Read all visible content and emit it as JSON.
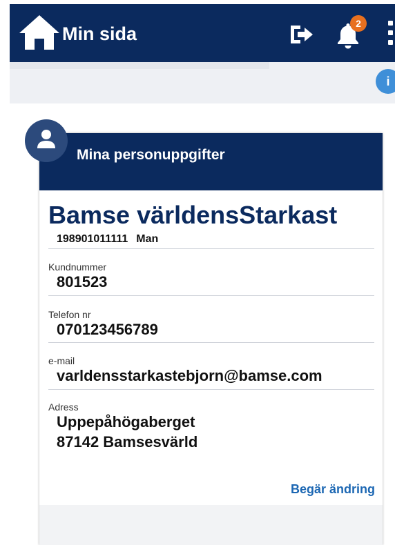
{
  "header": {
    "title": "Min sida",
    "icons": [
      "home-icon",
      "logout-icon",
      "bell-icon",
      "more-vertical-icon"
    ],
    "notification_count": "2"
  },
  "subbar": {
    "info_label": "i"
  },
  "profile": {
    "section_title": "Mina personuppgifter",
    "name": "Bamse världensStarkast",
    "personnummer": "198901011111",
    "gender": "Man",
    "fields": [
      {
        "label": "Kundnummer",
        "value": "801523"
      },
      {
        "label": "Telefon nr",
        "value": "070123456789"
      },
      {
        "label": "e-mail",
        "value": "varldensstarkastebjorn@bamse.com"
      }
    ],
    "address": {
      "label": "Adress",
      "line1": "Uppepåhögaberget",
      "line2": "87142 Bamsesvärld"
    },
    "change_link": "Begär ändring"
  },
  "colors": {
    "brand": "#0b2a5e",
    "badge": "#e8701f",
    "link": "#1c67b3",
    "info": "#3f8fd8"
  }
}
